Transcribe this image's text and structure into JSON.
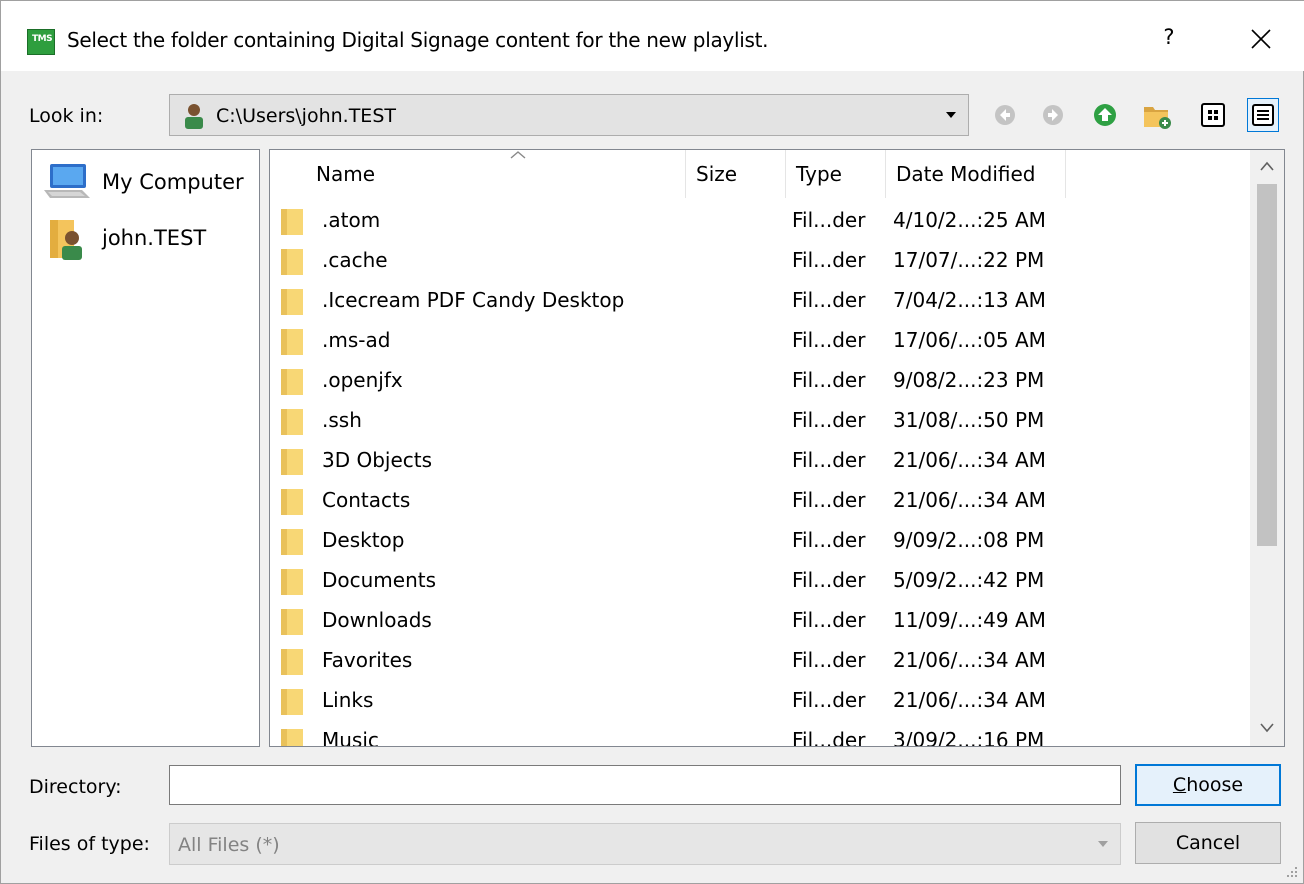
{
  "window": {
    "title": "Select the folder containing Digital Signage content for the new playlist.",
    "app_icon_text": "TMS",
    "help_label": "?"
  },
  "look_in": {
    "label": "Look in:",
    "path": "C:\\Users\\john.TEST"
  },
  "places": [
    {
      "label": "My Computer",
      "icon": "computer-icon"
    },
    {
      "label": "john.TEST",
      "icon": "user-folder-icon"
    }
  ],
  "columns": {
    "name": "Name",
    "size": "Size",
    "type": "Type",
    "date": "Date Modified",
    "sort_indicator": "ascending-on-name"
  },
  "files": [
    {
      "name": ".atom",
      "size": "",
      "type": "Fil...der",
      "date": "4/10/2...:25 AM"
    },
    {
      "name": ".cache",
      "size": "",
      "type": "Fil...der",
      "date": "17/07/...:22 PM"
    },
    {
      "name": ".Icecream PDF Candy Desktop",
      "size": "",
      "type": "Fil...der",
      "date": "7/04/2...:13 AM"
    },
    {
      "name": ".ms-ad",
      "size": "",
      "type": "Fil...der",
      "date": "17/06/...:05 AM"
    },
    {
      "name": ".openjfx",
      "size": "",
      "type": "Fil...der",
      "date": "9/08/2...:23 PM"
    },
    {
      "name": ".ssh",
      "size": "",
      "type": "Fil...der",
      "date": "31/08/...:50 PM"
    },
    {
      "name": "3D Objects",
      "size": "",
      "type": "Fil...der",
      "date": "21/06/...:34 AM"
    },
    {
      "name": "Contacts",
      "size": "",
      "type": "Fil...der",
      "date": "21/06/...:34 AM"
    },
    {
      "name": "Desktop",
      "size": "",
      "type": "Fil...der",
      "date": "9/09/2...:08 PM"
    },
    {
      "name": "Documents",
      "size": "",
      "type": "Fil...der",
      "date": "5/09/2...:42 PM"
    },
    {
      "name": "Downloads",
      "size": "",
      "type": "Fil...der",
      "date": "11/09/...:49 AM"
    },
    {
      "name": "Favorites",
      "size": "",
      "type": "Fil...der",
      "date": "21/06/...:34 AM"
    },
    {
      "name": "Links",
      "size": "",
      "type": "Fil...der",
      "date": "21/06/...:34 AM"
    },
    {
      "name": "Music",
      "size": "",
      "type": "Fil...der",
      "date": "3/09/2...:16 PM"
    }
  ],
  "directory": {
    "label": "Directory:",
    "value": ""
  },
  "files_of_type": {
    "label": "Files of type:",
    "value": "All Files (*)"
  },
  "buttons": {
    "choose_mnemonic": "C",
    "choose_rest": "hoose",
    "cancel": "Cancel"
  },
  "toolbar_icons": [
    "back-icon",
    "forward-icon",
    "up-folder-icon",
    "new-folder-icon",
    "list-view-icon",
    "details-view-icon"
  ],
  "colors": {
    "accent": "#0078d7",
    "folder": "#f8d775",
    "up_green": "#2ea043"
  }
}
